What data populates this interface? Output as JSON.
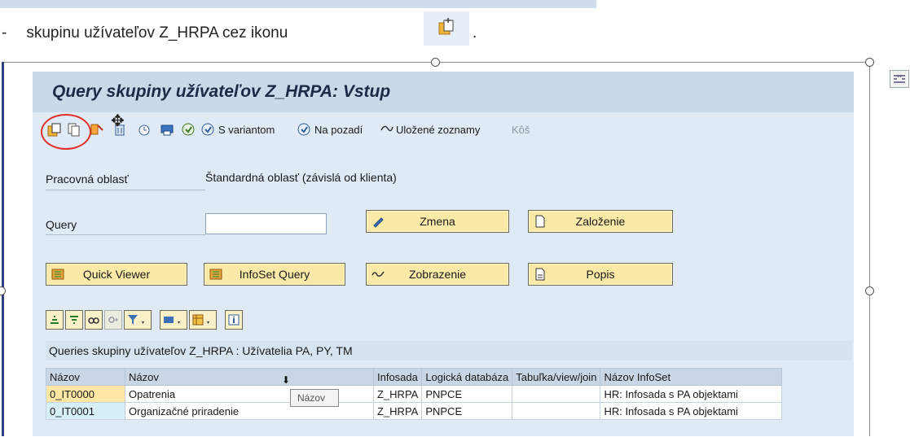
{
  "doc": {
    "bullet": "-",
    "instruction": "skupinu užívateľov  Z_HRPA cez ikonu",
    "period": "."
  },
  "window": {
    "title": "Query skupiny užívateľov Z_HRPA: Vstup"
  },
  "toolbar": {
    "variant_label": "S variantom",
    "background_label": "Na pozadí",
    "saved_lists_label": "Uložené zoznamy",
    "trash_label": "Kôš"
  },
  "form": {
    "work_area_label": "Pracovná oblasť",
    "work_area_value": "Štandardná oblasť (závislá od klienta)",
    "query_label": "Query",
    "query_value": "",
    "change_label": "Zmena",
    "create_label": "Založenie",
    "quick_viewer_label": "Quick Viewer",
    "infoset_query_label": "InfoSet Query",
    "display_label": "Zobrazenie",
    "description_label": "Popis"
  },
  "grid": {
    "title": "Queries skupiny užívateľov Z_HRPA : Užívatelia PA, PY, TM",
    "columns": [
      "Názov",
      "Názov",
      "Infosada",
      "Logická databáza",
      "Tabuľka/view/join",
      "Názov InfoSet"
    ],
    "rows": [
      [
        "0_IT0000",
        "Opatrenia",
        "Z_HRPA",
        "PNPCE",
        "",
        "HR: Infosada s PA objektami"
      ],
      [
        "0_IT0001",
        "Organizačné priradenie",
        "Z_HRPA",
        "PNPCE",
        "",
        "HR: Infosada s PA objektami"
      ]
    ],
    "tooltip": "Názov"
  },
  "colors": {
    "title_bar": "#c9d9ea",
    "background": "#dfeaf5",
    "button": "#fbe9a7",
    "highlight_circle": "#e0302a"
  }
}
